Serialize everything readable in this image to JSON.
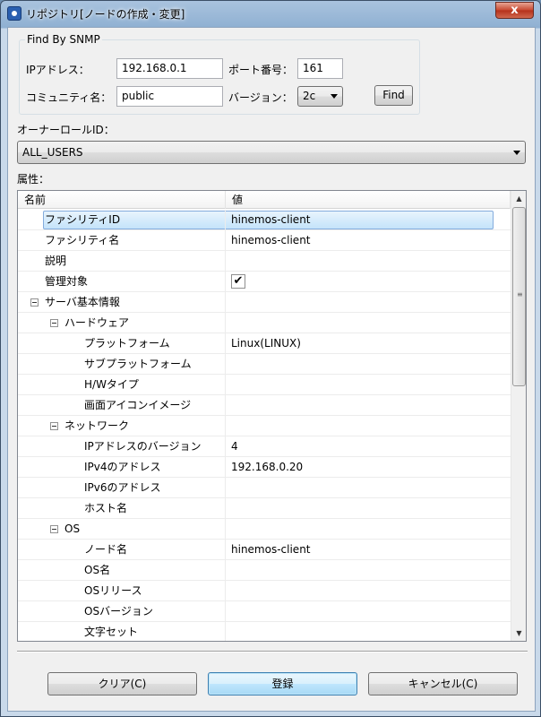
{
  "window": {
    "title": "リポジトリ[ノードの作成・変更]",
    "close_glyph": "x"
  },
  "snmp": {
    "group_label": "Find By SNMP",
    "ip_label": "IPアドレス：",
    "ip_value": "192.168.0.1",
    "port_label": "ポート番号：",
    "port_value": "161",
    "community_label": "コミュニティ名：",
    "community_value": "public",
    "version_label": "バージョン：",
    "version_value": "2c",
    "find_button": "Find"
  },
  "owner": {
    "label": "オーナーロールID：",
    "value": "ALL_USERS"
  },
  "attributes": {
    "label": "属性：",
    "columns": [
      "名前",
      "値"
    ],
    "rows": [
      {
        "name": "ファシリティID",
        "value": "hinemos-client",
        "level": 1,
        "selected": true
      },
      {
        "name": "ファシリティ名",
        "value": "hinemos-client",
        "level": 1
      },
      {
        "name": "説明",
        "value": "",
        "level": 1
      },
      {
        "name": "管理対象",
        "value": "✔",
        "level": 1,
        "checkbox": true
      },
      {
        "name": "サーバ基本情報",
        "value": "",
        "level": 1,
        "expander": true
      },
      {
        "name": "ハードウェア",
        "value": "",
        "level": 2,
        "expander": true
      },
      {
        "name": "プラットフォーム",
        "value": "Linux(LINUX)",
        "level": 3
      },
      {
        "name": "サブプラットフォーム",
        "value": "",
        "level": 3
      },
      {
        "name": "H/Wタイプ",
        "value": "",
        "level": 3
      },
      {
        "name": "画面アイコンイメージ",
        "value": "",
        "level": 3
      },
      {
        "name": "ネットワーク",
        "value": "",
        "level": 2,
        "expander": true
      },
      {
        "name": "IPアドレスのバージョン",
        "value": "4",
        "level": 3
      },
      {
        "name": "IPv4のアドレス",
        "value": "192.168.0.20",
        "level": 3
      },
      {
        "name": "IPv6のアドレス",
        "value": "",
        "level": 3
      },
      {
        "name": "ホスト名",
        "value": "",
        "level": 3
      },
      {
        "name": "OS",
        "value": "",
        "level": 2,
        "expander": true
      },
      {
        "name": "ノード名",
        "value": "hinemos-client",
        "level": 3
      },
      {
        "name": "OS名",
        "value": "",
        "level": 3
      },
      {
        "name": "OSリリース",
        "value": "",
        "level": 3
      },
      {
        "name": "OSバージョン",
        "value": "",
        "level": 3
      },
      {
        "name": "文字セット",
        "value": "",
        "level": 3
      }
    ]
  },
  "buttons": {
    "clear": "クリア(C)",
    "register": "登録",
    "cancel": "キャンセル(C)"
  }
}
